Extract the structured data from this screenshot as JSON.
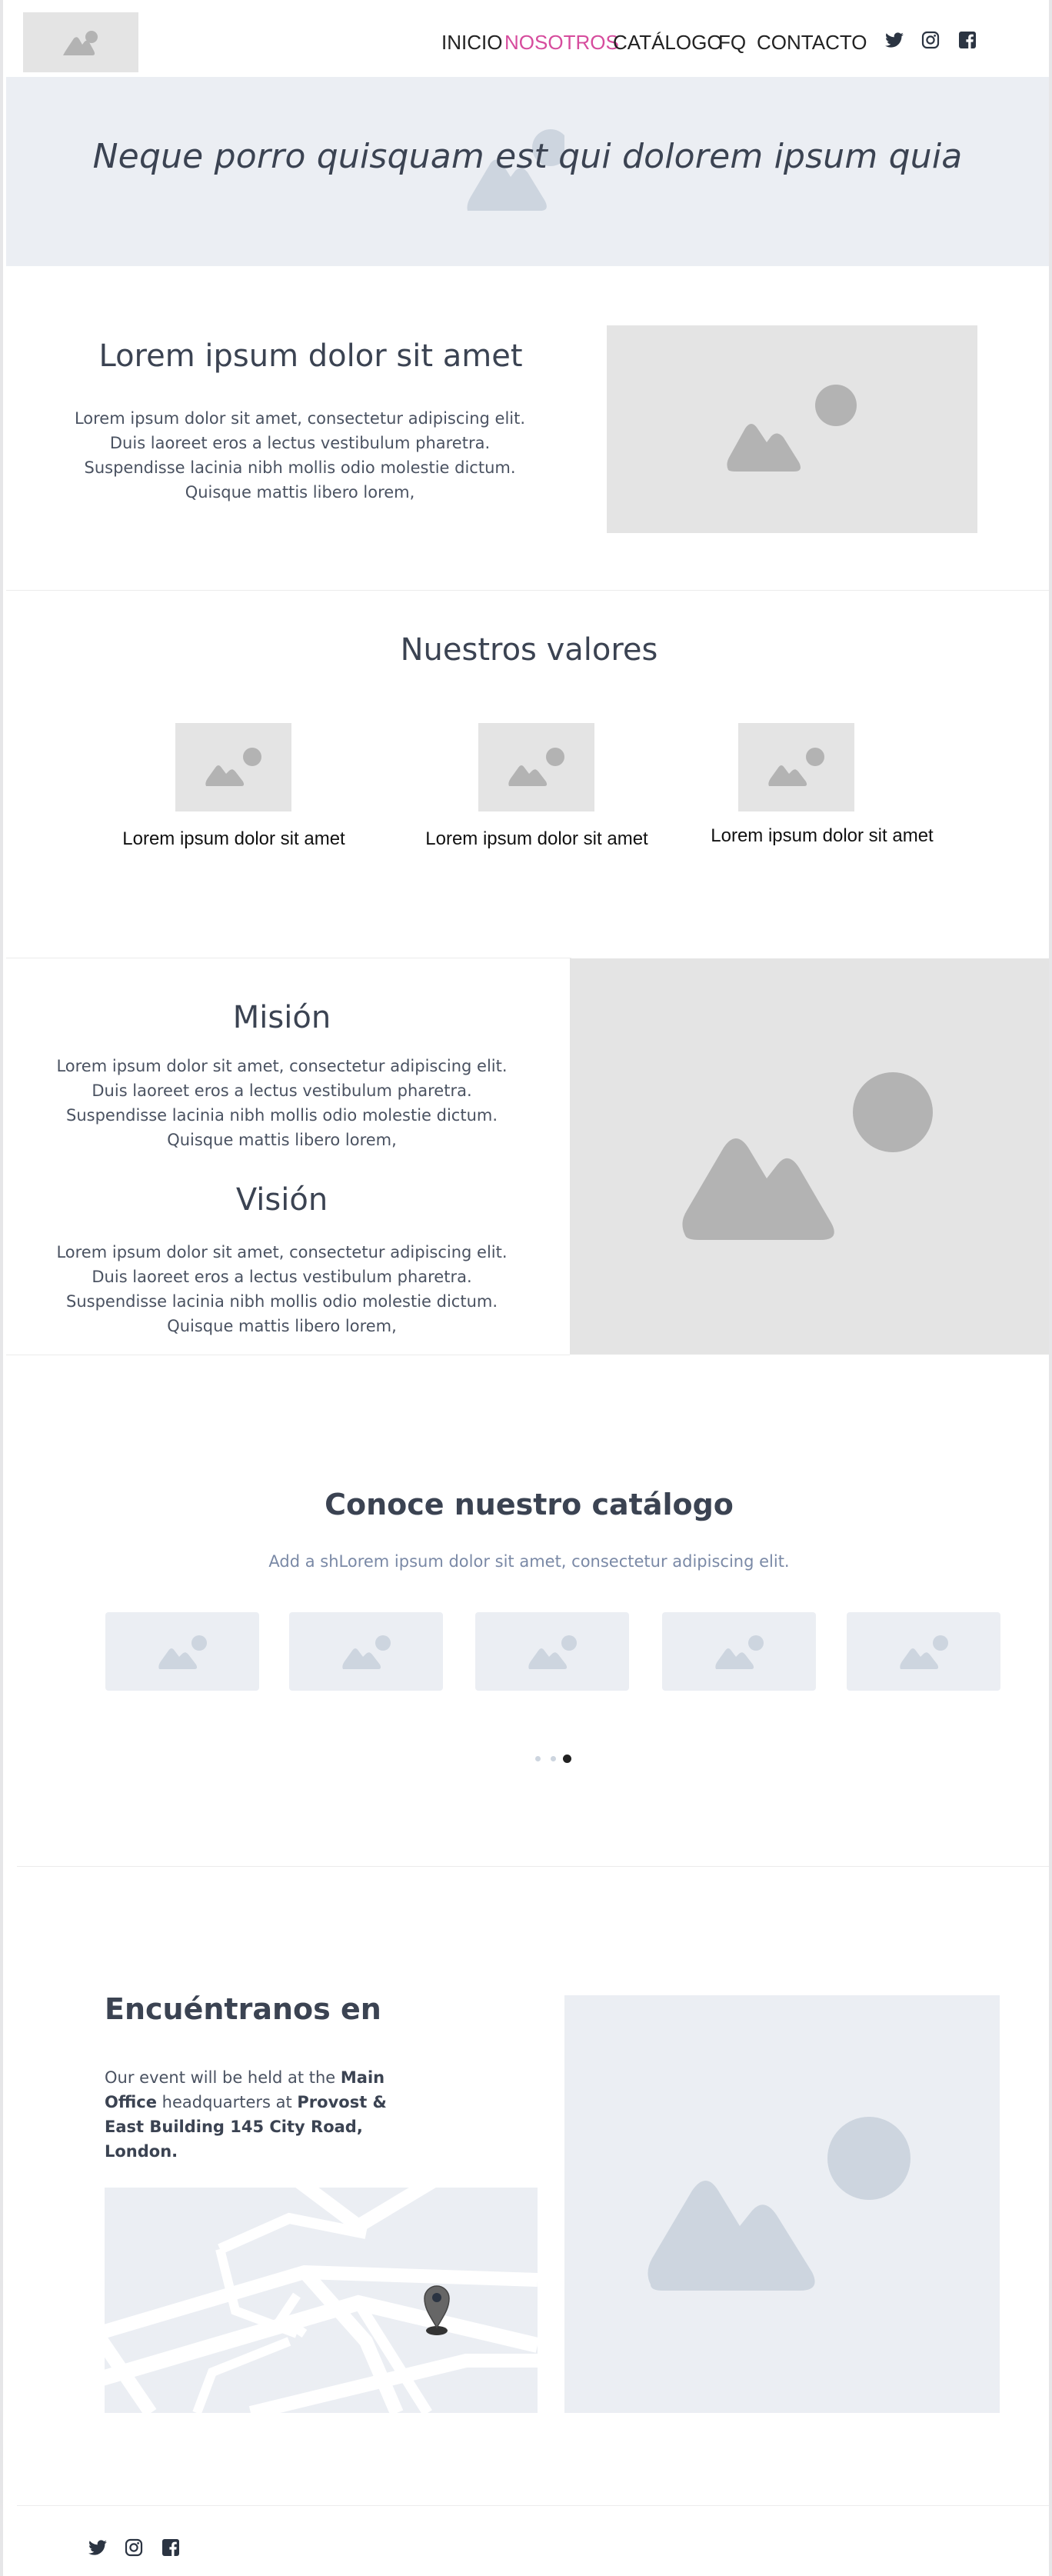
{
  "header": {
    "logo_icon": "image-placeholder-icon",
    "nav": [
      "INICIO",
      "NOSOTROS",
      "CATÁLOGO",
      "FQ",
      "CONTACTO"
    ],
    "active_nav": "NOSOTROS",
    "active_color": "#d64c9d",
    "social_icons": [
      "twitter-icon",
      "instagram-icon",
      "facebook-icon"
    ]
  },
  "hero": {
    "title": "Neque porro quisquam est qui dolorem ipsum quia",
    "background": "#ebeef3"
  },
  "intro": {
    "title": "Lorem ipsum dolor sit amet",
    "text": "Lorem ipsum dolor sit amet, consectetur adipiscing elit. Duis laoreet eros a lectus vestibulum pharetra. Suspendisse lacinia nibh mollis odio molestie dictum. Quisque mattis libero lorem,"
  },
  "values": {
    "title": "Nuestros valores",
    "items": [
      "Lorem ipsum dolor sit amet",
      "Lorem ipsum dolor sit amet",
      "Lorem ipsum dolor sit amet"
    ]
  },
  "mission": {
    "title": "Misión",
    "text": "Lorem ipsum dolor sit amet, consectetur adipiscing elit. Duis laoreet eros a lectus vestibulum pharetra. Suspendisse lacinia nibh mollis odio molestie dictum. Quisque mattis libero lorem,"
  },
  "vision": {
    "title": "Visión",
    "text": "Lorem ipsum dolor sit amet, consectetur adipiscing elit. Duis laoreet eros a lectus vestibulum pharetra. Suspendisse lacinia nibh mollis odio molestie dictum. Quisque mattis libero lorem,"
  },
  "catalog": {
    "title": "Conoce nuestro catálogo",
    "subtitle": "Add a shLorem ipsum dolor sit amet, consectetur adipiscing elit.",
    "item_count": 5,
    "active_dot": 3,
    "dot_count": 3
  },
  "find": {
    "title": "Encuéntranos en",
    "text_prefix": "Our event will be held at the ",
    "text_bold1": "Main Office",
    "text_mid": " headquarters at ",
    "text_bold2": "Provost & East Building 145 City Road, London.",
    "map_icon": "map-pin-icon"
  },
  "footer": {
    "social_icons": [
      "twitter-icon",
      "instagram-icon",
      "facebook-icon"
    ]
  },
  "colors": {
    "text": "#3b4352",
    "placeholder_gray": "#e4e4e4",
    "placeholder_light": "#ebeef3",
    "accent": "#d64c9d"
  }
}
